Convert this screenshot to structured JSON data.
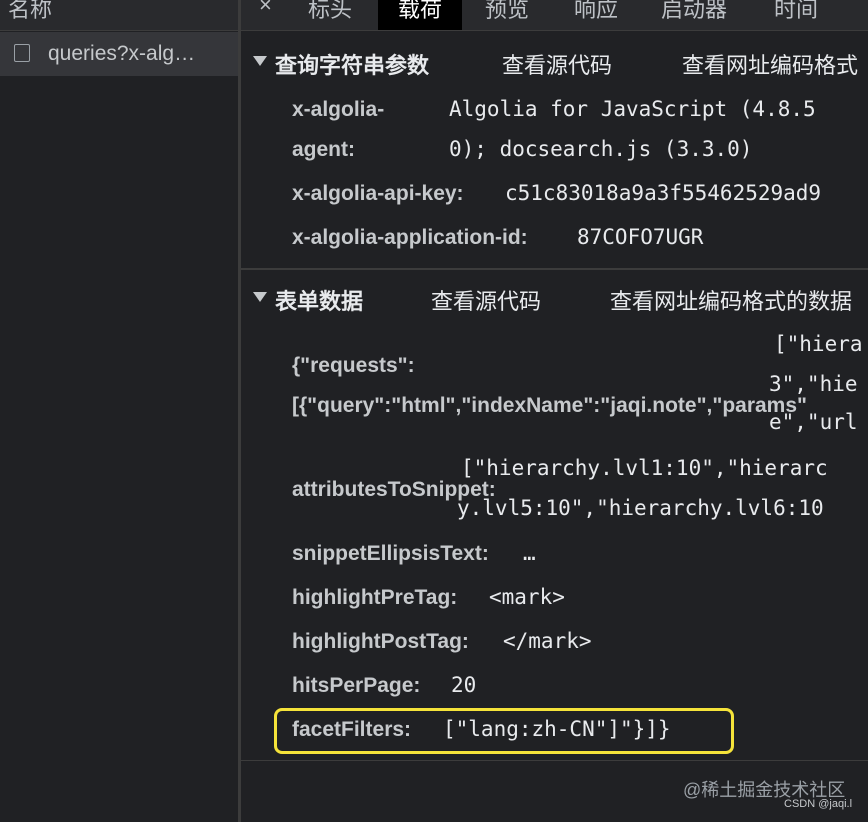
{
  "left": {
    "header": "名称",
    "request_name": "queries?x-alg…"
  },
  "tabs": {
    "close": "×",
    "items": [
      "标头",
      "载荷",
      "预览",
      "响应",
      "启动器",
      "时间"
    ],
    "active": "载荷"
  },
  "query_section": {
    "title": "查询字符串参数",
    "view_source": "查看源代码",
    "view_url_encoded": "查看网址编码格式",
    "params": [
      {
        "key_line1": "x-algolia-",
        "key_line2": "agent:",
        "value_line1": "Algolia for JavaScript (4.8.5",
        "value_line2": "0); docsearch.js (3.3.0)"
      },
      {
        "key": "x-algolia-api-key:",
        "value": "c51c83018a9a3f55462529ad9"
      },
      {
        "key": "x-algolia-application-id:",
        "value": "87COFO7UGR"
      }
    ]
  },
  "form_section": {
    "title": "表单数据",
    "view_source": "查看源代码",
    "view_url_encoded": "查看网址编码格式的数据",
    "requests_key_line1": "{\"requests\":",
    "requests_key_line2": "[{\"query\":\"html\",\"indexName\":\"jaqi.note\",\"params\"",
    "requests_val_line1": "[\"hiera",
    "requests_val_line2": "3\",\"hie",
    "requests_val_line3": "e\",\"url",
    "attr_key": "attributesToSnippet:",
    "attr_val_line1": "[\"hierarchy.lvl1:10\",\"hierarc",
    "attr_val_line2": "y.lvl5:10\",\"hierarchy.lvl6:10",
    "ellipsis_key": "snippetEllipsisText:",
    "ellipsis_val": "…",
    "pre_key": "highlightPreTag:",
    "pre_val": "<mark>",
    "post_key": "highlightPostTag:",
    "post_val": "</mark>",
    "hits_key": "hitsPerPage:",
    "hits_val": "20",
    "facet_key": "facetFilters:",
    "facet_val": "[\"lang:zh-CN\"]\"}]}"
  },
  "watermark": "@稀土掘金技术社区",
  "csdn": "CSDN @jaqi.l",
  "colors": {
    "background": "#202124",
    "highlight_box": "#f5e33a",
    "active_tab": "#000000"
  }
}
